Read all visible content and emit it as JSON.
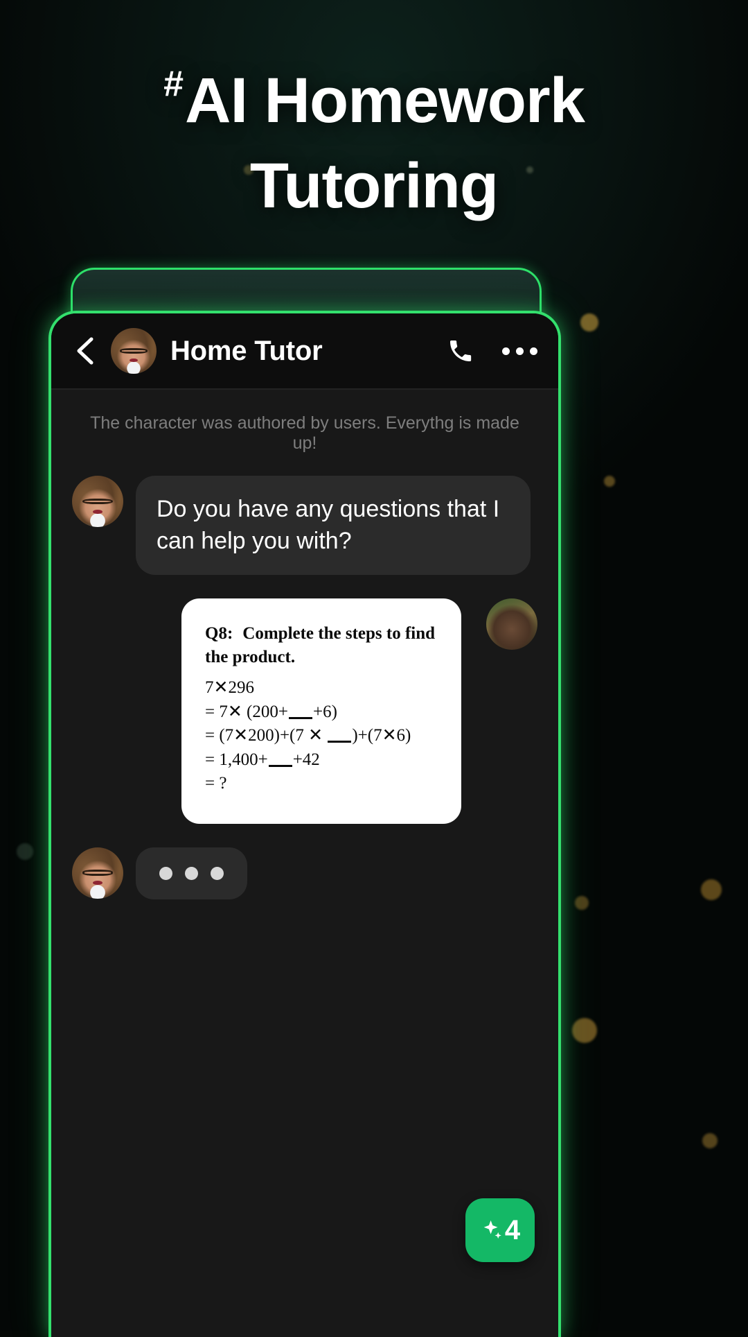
{
  "headline": {
    "hash": "#",
    "line1": "AI Homework",
    "line2": "Tutoring"
  },
  "colors": {
    "accent_green": "#33e06d",
    "badge_green": "#14b866",
    "bubble_gray": "#2b2b2b",
    "chat_bg": "#181818",
    "header_bg": "#0d0d0d",
    "card_white": "#ffffff"
  },
  "chat_header": {
    "back_icon": "chevron-left-icon",
    "avatar_icon": "tutor-avatar",
    "title": "Home Tutor",
    "call_icon": "phone-icon",
    "menu_icon": "more-options-icon"
  },
  "chat": {
    "disclaimer": "The character was authored by users. Everythg is made up!",
    "ai_message": "Do you have any questions that I can help you with?",
    "homework": {
      "question_number": "Q8:",
      "question_text": "Complete the steps to find the product.",
      "line1": "7✕296",
      "line2_pre": "= 7✕  (200+",
      "line2_post": "+6)",
      "line3_pre": "= (7✕200)+(7 ✕ ",
      "line3_post": ")+(7✕6)",
      "line4_pre": "= 1,400+",
      "line4_post": "+42",
      "line5": "= ?"
    },
    "typing_indicator": "typing-dots"
  },
  "fab": {
    "icon": "sparkle-icon",
    "count": "4"
  }
}
